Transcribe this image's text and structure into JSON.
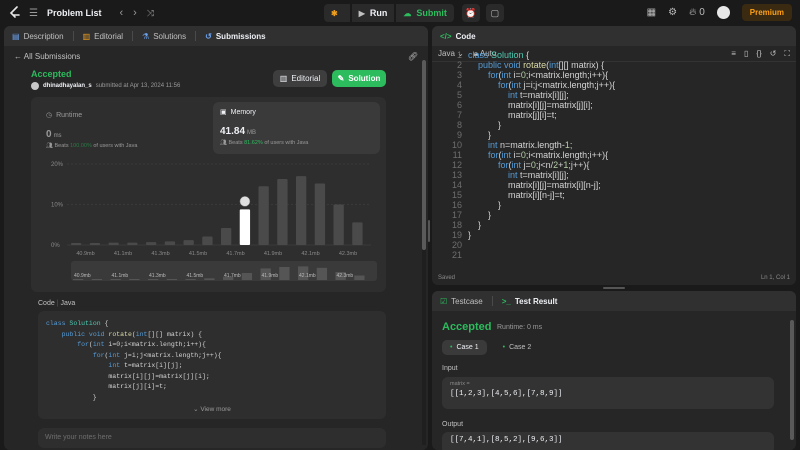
{
  "topbar": {
    "title": "Problem List",
    "run_label": "Run",
    "submit_label": "Submit",
    "streak": "0",
    "premium_label": "Premium"
  },
  "left_tabs": [
    "Description",
    "Editorial",
    "Solutions",
    "Submissions"
  ],
  "submission": {
    "back_label": "All Submissions",
    "status": "Accepted",
    "user": "dhinadhayalan_s",
    "submitted_text": "submitted at Apr 13, 2024 11:56",
    "editorial_btn": "Editorial",
    "solution_btn": "Solution",
    "runtime": {
      "label": "Runtime",
      "value": "0",
      "unit": "ms",
      "beats_prefix": "Beats",
      "beats_pct": "100.00%",
      "beats_suffix": "of users with Java"
    },
    "memory": {
      "label": "Memory",
      "value": "41.84",
      "unit": "MB",
      "beats_prefix": "Beats",
      "beats_pct": "81.62%",
      "beats_suffix": "of users with Java"
    },
    "code_label": "Code",
    "code_lang": "Java",
    "code_lines": [
      "class Solution {",
      "    public void rotate(int[][] matrix) {",
      "        for(int i=0;i<matrix.length;i++){",
      "            for(int j=i;j<matrix.length;j++){",
      "                int t=matrix[i][j];",
      "                matrix[i][j]=matrix[j][i];",
      "                matrix[j][i]=t;",
      "            }"
    ],
    "view_more": "View more",
    "notes_placeholder": "Write your notes here"
  },
  "chart_data": {
    "type": "bar",
    "ylabel": "",
    "yticks": [
      "20%",
      "10%",
      "0%"
    ],
    "ylim": [
      0,
      20
    ],
    "xlabels": [
      "40.9mb",
      "41.1mb",
      "41.3mb",
      "41.5mb",
      "41.7mb",
      "41.9mb",
      "42.1mb",
      "42.3mb"
    ],
    "values": [
      0.5,
      0.5,
      0.6,
      0.6,
      0.7,
      0.9,
      1.2,
      2.1,
      4.2,
      8.8,
      14.5,
      16.3,
      17.0,
      15.2,
      10.0,
      5.6
    ],
    "highlight_index": 9,
    "overview_labels": [
      "40.9mb",
      "41.1mb",
      "41.3mb",
      "41.5mb",
      "41.7mb",
      "41.9mb",
      "42.1mb",
      "42.3mb"
    ]
  },
  "editor": {
    "title": "Code",
    "language": "Java",
    "mode": "Auto",
    "line_numbers": [
      "1",
      "2",
      "3",
      "4",
      "5",
      "6",
      "7",
      "8",
      "9",
      "10",
      "11",
      "12",
      "13",
      "14",
      "15",
      "16",
      "17",
      "18",
      "19",
      "20",
      "21"
    ],
    "status_left": "Saved",
    "status_right": "Ln 1, Col 1"
  },
  "testpanel": {
    "tab_testcase": "Testcase",
    "tab_result": "Test Result",
    "status": "Accepted",
    "runtime": "Runtime: 0 ms",
    "case1": "Case 1",
    "case2": "Case 2",
    "input_label": "Input",
    "input_var": "matrix =",
    "input_value": "[[1,2,3],[4,5,6],[7,8,9]]",
    "output_label": "Output",
    "output_value": "[[7,4,1],[8,5,2],[9,6,3]]"
  },
  "colors": {
    "accent_green": "#2cbb5d",
    "brand_orange": "#ffa116",
    "bar_gray": "#4a4a4a",
    "bar_highlight": "#ffffff"
  }
}
